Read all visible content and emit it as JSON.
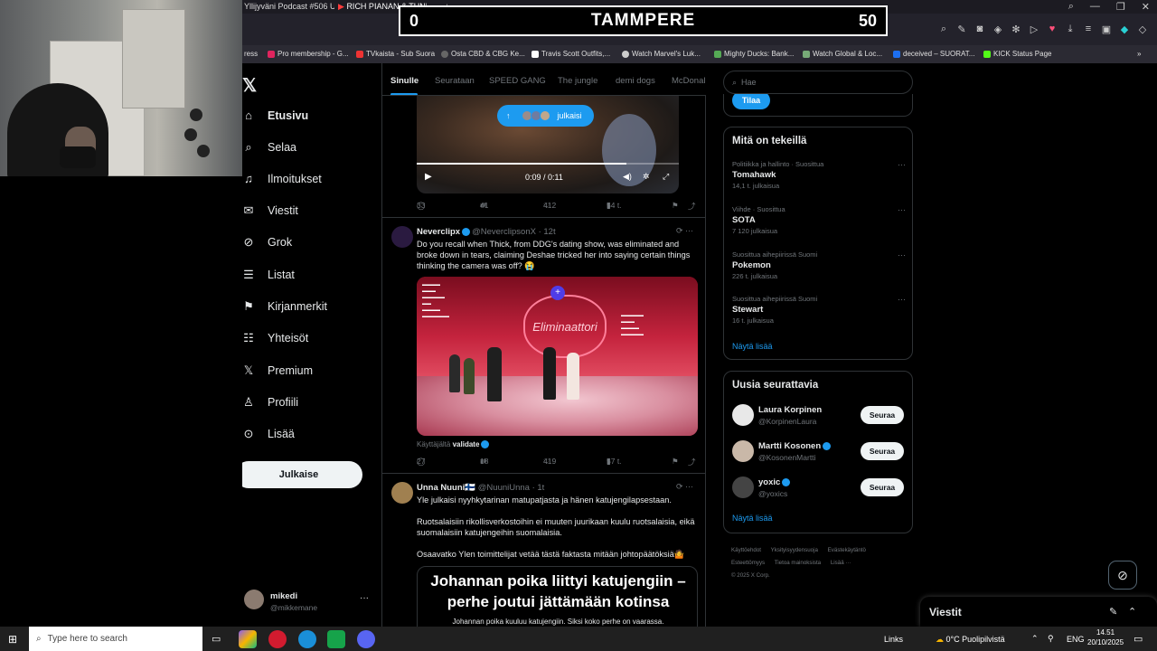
{
  "browser": {
    "tabs": [
      "Yllijyväni Podcast #506 UF",
      "RICH PIANAN & TUNNIN"
    ],
    "window_controls": [
      "—",
      "❐",
      "✕"
    ]
  },
  "scoreboard": {
    "left_score": "0",
    "team": "TAMMPERE",
    "right_score": "50"
  },
  "bookmarks": [
    "ress",
    "Pro membership - G...",
    "TVkaista - Sub Suora",
    "Osta CBD & CBG Ke...",
    "Travis Scott Outfits,...",
    "Watch Marvel's Luk...",
    "Mighty Ducks: Bank...",
    "Watch Global & Loc...",
    "deceived – SUORAT...",
    "KICK Status Page"
  ],
  "nav": {
    "items": [
      "Etusivu",
      "Selaa",
      "Ilmoitukset",
      "Viestit",
      "Grok",
      "Listat",
      "Kirjanmerkit",
      "Yhteisöt",
      "Premium",
      "Profiili",
      "Lisää"
    ],
    "post_button": "Julkaise",
    "account": {
      "name": "mikedi",
      "handle": "@mikkemane"
    }
  },
  "feed": {
    "tabs": [
      "Sinulle",
      "Seurataan",
      "SPEED GANG",
      "The jungle",
      "demi dogs",
      "McDonal"
    ],
    "new_posts_label": "julkaisi",
    "video": {
      "time": "0:09 / 0:11"
    },
    "tweet0_actions": {
      "replies": "33",
      "reposts": "41",
      "likes": "412",
      "views": "54 t."
    },
    "tweet1": {
      "name": "Neverclipx",
      "handle": "@NeverclipsonX · 12t",
      "text": "Do you recall when Thick, from DDG's dating show, was eliminated and broke down in tears, claiming Deshae tricked her into saying certain things thinking the camera was off? 😭",
      "media_sign": "Eliminaattori",
      "caption_prefix": "Käyttäjältä",
      "caption_user": "validate",
      "actions": {
        "replies": "27",
        "reposts": "18",
        "likes": "419",
        "views": "57 t."
      }
    },
    "tweet2": {
      "name": "Unna Nuuni🇫🇮",
      "handle": "@NuuniUnna · 1t",
      "p1": "Yle julkaisi nyyhkytarinan matupatjasta ja hänen katujengilapsestaan.",
      "p2": "Ruotsalaisiin rikollisverkostoihin ei muuten juurikaan kuulu ruotsalaisia, eikä suomalaisiin katujengeihin suomalaisia.",
      "p3": "Osaavatko Ylen toimittelijat vetää tästä faktasta mitään johtopäätöksiä🤷",
      "card_title": "Johannan poika liittyi katujengiin – perhe joutui jättämään kotinsa",
      "card_sub": "Johannan poika kuuluu katujengiin. Siksi koko perhe on vaarassa."
    }
  },
  "sidebar": {
    "search_placeholder": "Hae",
    "subscribe": "Tilaa",
    "trends_title": "Mitä on tekeillä",
    "trends": [
      {
        "context": "Politiikka ja hallinto · Suosittua",
        "name": "Tomahawk",
        "posts": "14,1 t. julkaisua"
      },
      {
        "context": "Viihde · Suosittua",
        "name": "SOTA",
        "posts": "7 120 julkaisua"
      },
      {
        "context": "Suosittua aihepiirissä Suomi",
        "name": "Pokemon",
        "posts": "226 t. julkaisua"
      },
      {
        "context": "Suosittua aihepiirissä Suomi",
        "name": "Stewart",
        "posts": "16 t. julkaisua"
      }
    ],
    "show_more": "Näytä lisää",
    "who_title": "Uusia seurattavia",
    "who": [
      {
        "name": "Laura Korpinen",
        "handle": "@KorpinenLaura",
        "follow": "Seuraa"
      },
      {
        "name": "Martti Kosonen",
        "handle": "@KosonenMartti",
        "follow": "Seuraa"
      },
      {
        "name": "yoxic",
        "handle": "@yoxics",
        "follow": "Seuraa"
      }
    ],
    "footer": [
      "Käyttöehdot",
      "Yksityisyydensuoja",
      "Evästekäytäntö",
      "Esteettömyys",
      "Tietoa mainoksista",
      "Lisää ···",
      "© 2025 X Corp."
    ]
  },
  "messages_drawer": {
    "title": "Viestit"
  },
  "taskbar": {
    "search_placeholder": "Type here to search",
    "links": "Links",
    "weather": "0°C  Puolipilvistä",
    "lang": "ENG",
    "time": "14.51",
    "date": "20/10/2025"
  },
  "colors": {
    "accent": "#1d9bf0",
    "background": "#000000",
    "border": "#2f3336",
    "muted": "#71767b"
  }
}
